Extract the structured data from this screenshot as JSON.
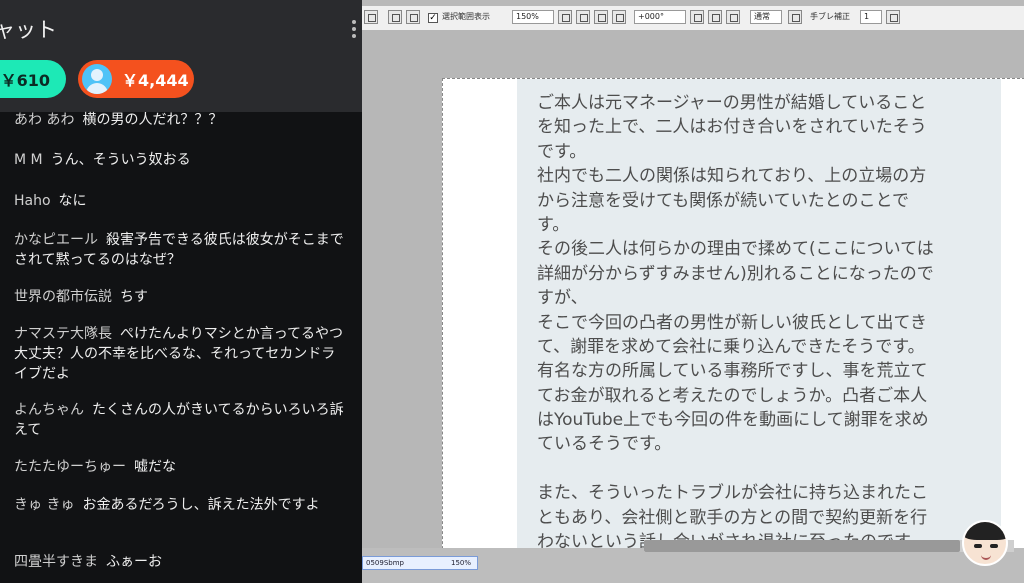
{
  "chat": {
    "title": "ャット",
    "super_chats": [
      {
        "amount": "￥610",
        "color": "#1de9b6"
      },
      {
        "amount": "￥4,444",
        "color": "#f4511e"
      }
    ],
    "messages": [
      {
        "author": "あわ あわ",
        "text": "横の男の人だれ？？？"
      },
      {
        "author": "M M",
        "text": "うん、そういう奴おる"
      },
      {
        "author": "Haho",
        "text": "なに"
      },
      {
        "author": "かなピエール",
        "text": "殺害予告できる彼氏は彼女がそこまでされて黙ってるのはなぜ？"
      },
      {
        "author": "世界の都市伝説",
        "text": "ちす"
      },
      {
        "author": "ナマステ大隊長",
        "text": "ぺけたんよりマシとか言ってるやつ大丈夫？人の不幸を比べるな、それってセカンドライブだよ"
      },
      {
        "author": "よんちゃん",
        "text": "たくさんの人がきいてるからいろいろ訴えて"
      },
      {
        "author": "たたたゆーちゅー",
        "text": "嘘だな"
      },
      {
        "author": "きゅ きゅ",
        "text": "お金あるだろうし、訴えた法外ですよ"
      },
      {
        "author": "四畳半すきま",
        "text": "ふぁーお"
      }
    ]
  },
  "editor": {
    "toolbar": {
      "checkbox_label": "選択範囲表示",
      "zoom": "150%",
      "angle": "+000°",
      "blend_mode": "通常",
      "stabilizer_label": "手ブレ補正",
      "stabilizer_value": "1"
    },
    "text_lines": [
      "ご本人は元マネージャーの男性が結婚していること",
      "を知った上で、二人はお付き合いをされていたそう",
      "です。",
      "社内でも二人の関係は知られており、上の立場の方",
      "から注意を受けても関係が続いていたとのことで",
      "す。",
      "その後二人は何らかの理由で揉めて(ここについては",
      "詳細が分からずすみません)別れることになったので",
      "すが、",
      "そこで今回の凸者の男性が新しい彼氏として出てき",
      "て、謝罪を求めて会社に乗り込んできたそうです。",
      "有名な方の所属している事務所ですし、事を荒立て",
      "てお金が取れると考えたのでしょうか。凸者ご本人",
      "はYouTube上でも今回の件を動画にして謝罪を求め",
      "ているそうです。",
      "",
      "また、そういったトラブルが会社に持ち込まれたこ",
      "ともあり、会社側と歌手の方との間で契約更新を行",
      "わないという話し合いがされ退社に至ったのです"
    ],
    "status": {
      "filename": "0509Sbmp",
      "zoom": "150%"
    }
  }
}
